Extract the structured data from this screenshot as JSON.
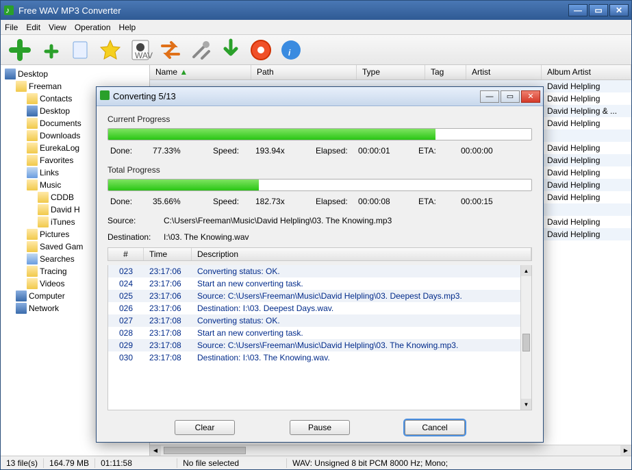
{
  "window": {
    "title": "Free WAV MP3 Converter",
    "wbtn_min": "—",
    "wbtn_max": "▭",
    "wbtn_close": "✕"
  },
  "menu": [
    "File",
    "Edit",
    "View",
    "Operation",
    "Help"
  ],
  "icons": {
    "add": "add",
    "addfile": "add-small",
    "refresh": "refresh",
    "star": "star",
    "disk": "disk",
    "cycle": "cycle",
    "tools": "tools",
    "download": "download",
    "help": "help",
    "info": "info"
  },
  "columns": {
    "name": "Name",
    "path": "Path",
    "type": "Type",
    "tag": "Tag",
    "artist": "Artist",
    "albumartist": "Album Artist"
  },
  "tree": {
    "desktop": "Desktop",
    "freeman": "Freeman",
    "contacts": "Contacts",
    "desktop2": "Desktop",
    "documents": "Documents",
    "downloads": "Downloads",
    "eureka": "EurekaLog",
    "favorites": "Favorites",
    "links": "Links",
    "music": "Music",
    "cddb": "CDDB",
    "david": "David H",
    "itunes": "iTunes",
    "pictures": "Pictures",
    "saved": "Saved Gam",
    "searches": "Searches",
    "tracing": "Tracing",
    "videos": "Videos",
    "computer": "Computer",
    "network": "Network"
  },
  "rows": [
    {
      "aa": "David Helpling"
    },
    {
      "aa": "David Helpling"
    },
    {
      "aa": "David Helpling & ..."
    },
    {
      "aa": "David Helpling"
    },
    {
      "aa": ""
    },
    {
      "aa": "David Helpling"
    },
    {
      "aa": "David Helpling"
    },
    {
      "aa": "David Helpling"
    },
    {
      "aa": "David Helpling"
    },
    {
      "aa": "David Helpling"
    },
    {
      "aa": ""
    },
    {
      "aa": "David Helpling"
    },
    {
      "aa": "David Helpling"
    }
  ],
  "statusbar": {
    "files": "13 file(s)",
    "size": "164.79 MB",
    "dur": "01:11:58",
    "nofile": "No file selected",
    "fmt": "WAV:   Unsigned 8 bit PCM  8000 Hz;  Mono;"
  },
  "dialog": {
    "title": "Converting 5/13",
    "wbtn_min": "—",
    "wbtn_max": "▭",
    "wbtn_close": "✕",
    "current": {
      "label": "Current Progress",
      "done_lbl": "Done:",
      "done": "77.33%",
      "speed_lbl": "Speed:",
      "speed": "193.94x",
      "elapsed_lbl": "Elapsed:",
      "elapsed": "00:00:01",
      "eta_lbl": "ETA:",
      "eta": "00:00:00",
      "pct": 77.33
    },
    "total": {
      "label": "Total Progress",
      "done_lbl": "Done:",
      "done": "35.66%",
      "speed_lbl": "Speed:",
      "speed": "182.73x",
      "elapsed_lbl": "Elapsed:",
      "elapsed": "00:00:08",
      "eta_lbl": "ETA:",
      "eta": "00:00:15",
      "pct": 35.66
    },
    "source_lbl": "Source:",
    "source": "C:\\Users\\Freeman\\Music\\David Helpling\\03. The Knowing.mp3",
    "dest_lbl": "Destination:",
    "dest": "I:\\03. The Knowing.wav",
    "logcols": {
      "n": "#",
      "time": "Time",
      "desc": "Description"
    },
    "log": [
      {
        "n": "023",
        "t": "23:17:06",
        "d": "Converting status: OK."
      },
      {
        "n": "024",
        "t": "23:17:06",
        "d": "Start an new converting task."
      },
      {
        "n": "025",
        "t": "23:17:06",
        "d": "Source:  C:\\Users\\Freeman\\Music\\David Helpling\\03. Deepest Days.mp3."
      },
      {
        "n": "026",
        "t": "23:17:06",
        "d": "Destination: I:\\03. Deepest Days.wav."
      },
      {
        "n": "027",
        "t": "23:17:08",
        "d": "Converting status: OK."
      },
      {
        "n": "028",
        "t": "23:17:08",
        "d": "Start an new converting task."
      },
      {
        "n": "029",
        "t": "23:17:08",
        "d": "Source:  C:\\Users\\Freeman\\Music\\David Helpling\\03. The Knowing.mp3."
      },
      {
        "n": "030",
        "t": "23:17:08",
        "d": "Destination: I:\\03. The Knowing.wav."
      }
    ],
    "btn_clear": "Clear",
    "btn_pause": "Pause",
    "btn_cancel": "Cancel"
  }
}
